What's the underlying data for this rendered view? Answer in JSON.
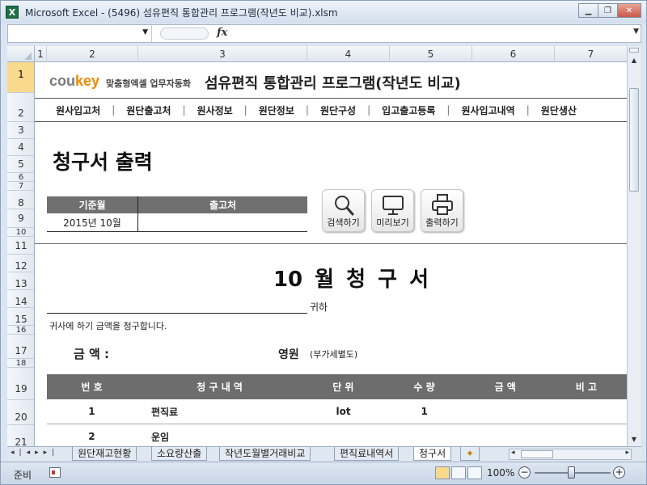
{
  "window": {
    "title": "Microsoft Excel - (5496) 섬유편직 통합관리 프로그램(작년도 비교).xlsm",
    "app_icon": "X"
  },
  "formula_bar": {
    "name_box": "",
    "fx_label": "fx",
    "formula": ""
  },
  "columns": [
    "1",
    "2",
    "3",
    "4",
    "5",
    "6",
    "7"
  ],
  "rows": [
    "1",
    "2",
    "3",
    "4",
    "5",
    "6",
    "7",
    "8",
    "9",
    "10",
    "11",
    "12",
    "13",
    "14",
    "15",
    "16",
    "17",
    "18",
    "19",
    "20",
    "21"
  ],
  "sheet": {
    "logo_main": "cou",
    "logo_accent": "key",
    "logo_sub": "맞춤형엑셀 업무자동화",
    "app_title": "섬유편직 통합관리 프로그램(작년도 비교)",
    "menu": [
      "원사입고처",
      "원단출고처",
      "원사정보",
      "원단정보",
      "원단구성",
      "입고출고등록",
      "원사입고내역",
      "원단생산"
    ],
    "heading": "청구서 출력",
    "filter": {
      "header_month": "기준월",
      "header_dest": "출고처",
      "value_month": "2015년 10월",
      "value_dest": ""
    },
    "buttons": [
      {
        "label": "검색하기",
        "icon": "search-icon"
      },
      {
        "label": "미리보기",
        "icon": "preview-monitor-icon"
      },
      {
        "label": "출력하기",
        "icon": "printer-icon"
      }
    ],
    "invoice_title": "10 월  청 구 서",
    "recipient_suffix": "귀하",
    "intro": "귀사에 하기 금액을 청구합니다.",
    "amount_label": "금 액 :",
    "amount_unit": "영원",
    "amount_note": "(부가세별도)",
    "table": {
      "headers": [
        "번 호",
        "청 구 내 역",
        "단 위",
        "수 량",
        "금 액",
        "비 고"
      ],
      "rows": [
        [
          "1",
          "편직료",
          "lot",
          "1",
          "",
          ""
        ],
        [
          "2",
          "운임",
          "",
          "",
          "",
          ""
        ]
      ]
    }
  },
  "tabs": [
    "원단재고현황",
    "소요량산출",
    "작년도월별거래비교",
    "편직료내역서",
    "청구서"
  ],
  "active_tab": "청구서",
  "status": {
    "ready": "준비",
    "zoom": "100%"
  },
  "colors": {
    "logo_accent": "#f08a00",
    "header_fill": "#707070",
    "selected_row_header": "#f9d98b"
  }
}
